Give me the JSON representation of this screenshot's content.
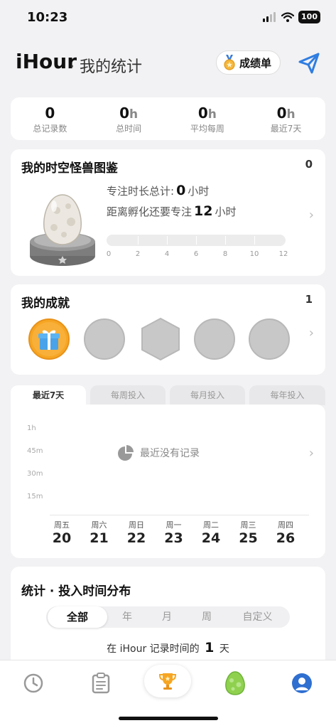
{
  "status": {
    "time": "10:23",
    "battery": "100"
  },
  "header": {
    "app_name": "iHour",
    "subtitle": "· 我的统计",
    "report_button": "成绩单"
  },
  "summary": [
    {
      "value": "0",
      "unit": "",
      "label": "总记录数"
    },
    {
      "value": "0",
      "unit": "h",
      "label": "总时间"
    },
    {
      "value": "0",
      "unit": "h",
      "label": "平均每周"
    },
    {
      "value": "0",
      "unit": "h",
      "label": "最近7天"
    }
  ],
  "monster": {
    "title": "我的时空怪兽图鉴",
    "count": "0",
    "focus_total_prefix": "专注时长总计:",
    "focus_total_value": "0",
    "focus_total_unit": "小时",
    "hatch_prefix": "距离孵化还要专注",
    "hatch_value": "12",
    "hatch_unit": "小时",
    "progress_value": 0,
    "progress_max": 12,
    "progress_labels": [
      "0",
      "2",
      "4",
      "6",
      "8",
      "10",
      "12"
    ]
  },
  "achievements": {
    "title": "我的成就",
    "count": "1"
  },
  "trend": {
    "tabs": [
      "最近7天",
      "每周投入",
      "每月投入",
      "每年投入"
    ],
    "active_tab": 0,
    "y_labels": [
      "1h",
      "45m",
      "30m",
      "15m"
    ],
    "empty_message": "最近没有记录",
    "days": [
      {
        "weekday": "周五",
        "date": "20"
      },
      {
        "weekday": "周六",
        "date": "21"
      },
      {
        "weekday": "周日",
        "date": "22"
      },
      {
        "weekday": "周一",
        "date": "23"
      },
      {
        "weekday": "周二",
        "date": "24"
      },
      {
        "weekday": "周三",
        "date": "25"
      },
      {
        "weekday": "周四",
        "date": "26"
      }
    ]
  },
  "distribution": {
    "title": "统计 · 投入时间分布",
    "segments": [
      "全部",
      "年",
      "月",
      "周",
      "自定义"
    ],
    "active_segment": 0,
    "record_prefix": "在 iHour 记录时间的",
    "record_days": "1",
    "record_suffix": "天"
  },
  "tabbar": {
    "items": [
      "clock-icon",
      "clipboard-icon",
      "trophy-icon",
      "egg-icon",
      "profile-icon"
    ],
    "active": 2
  },
  "colors": {
    "accent": "#2f7de1",
    "gold": "#f6a623",
    "egg_green": "#8fd14f",
    "background": "#f2f2f4"
  }
}
